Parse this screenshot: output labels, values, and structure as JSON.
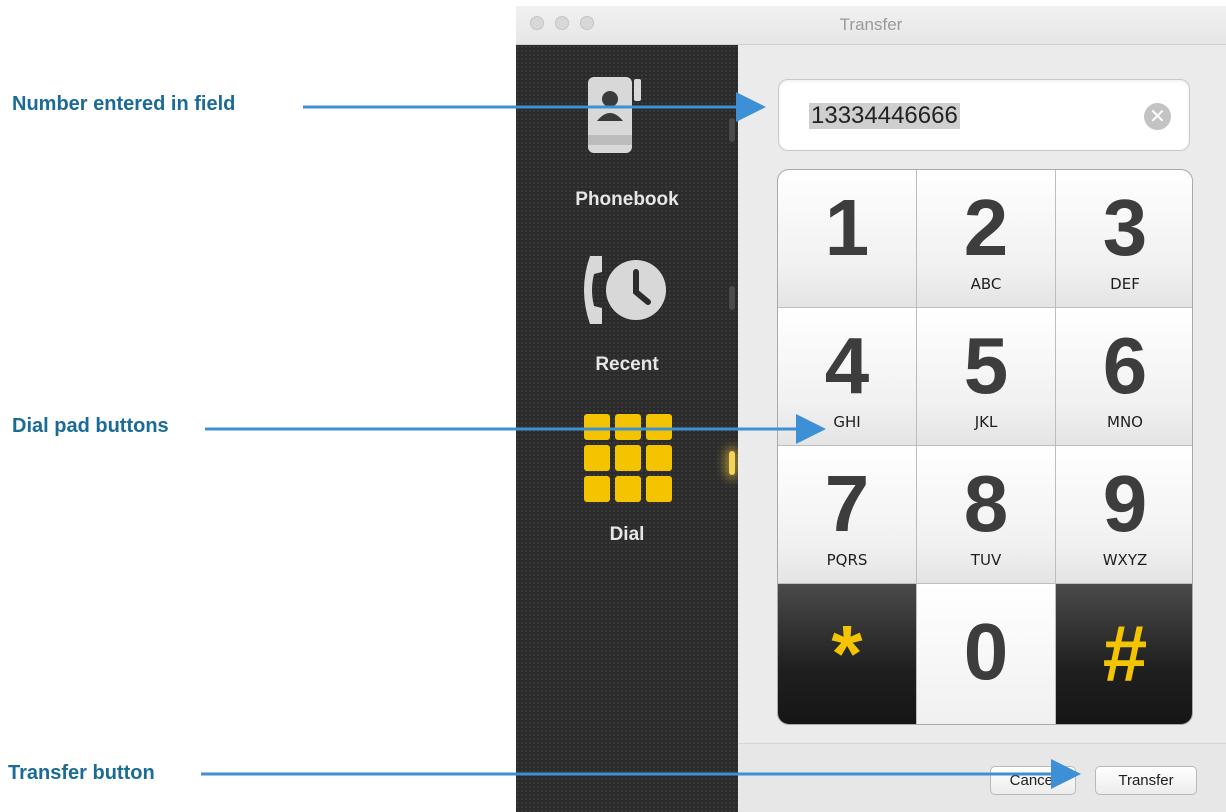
{
  "window": {
    "title": "Transfer"
  },
  "callouts": {
    "number_field": "Number entered in field",
    "dial_pad": "Dial pad buttons",
    "transfer_button": "Transfer button"
  },
  "sidebar": {
    "items": [
      {
        "label": "Phonebook",
        "icon": "phonebook-icon",
        "active": false
      },
      {
        "label": "Recent",
        "icon": "recent-calls-icon",
        "active": false
      },
      {
        "label": "Dial",
        "icon": "dialpad-icon",
        "active": true
      }
    ]
  },
  "number_field": {
    "value": "13334446666",
    "clear_icon": "clear-icon"
  },
  "keypad": {
    "keys": [
      {
        "digit": "1",
        "letters": ""
      },
      {
        "digit": "2",
        "letters": "ABC"
      },
      {
        "digit": "3",
        "letters": "DEF"
      },
      {
        "digit": "4",
        "letters": "GHI"
      },
      {
        "digit": "5",
        "letters": "JKL"
      },
      {
        "digit": "6",
        "letters": "MNO"
      },
      {
        "digit": "7",
        "letters": "PQRS"
      },
      {
        "digit": "8",
        "letters": "TUV"
      },
      {
        "digit": "9",
        "letters": "WXYZ"
      },
      {
        "digit": "*",
        "letters": ""
      },
      {
        "digit": "0",
        "letters": ""
      },
      {
        "digit": "#",
        "letters": ""
      }
    ]
  },
  "buttons": {
    "cancel": "Cancel",
    "transfer": "Transfer"
  },
  "colors": {
    "callout": "#1a6b95",
    "accent_yellow": "#f5c400",
    "arrow": "#3d8fd6"
  }
}
